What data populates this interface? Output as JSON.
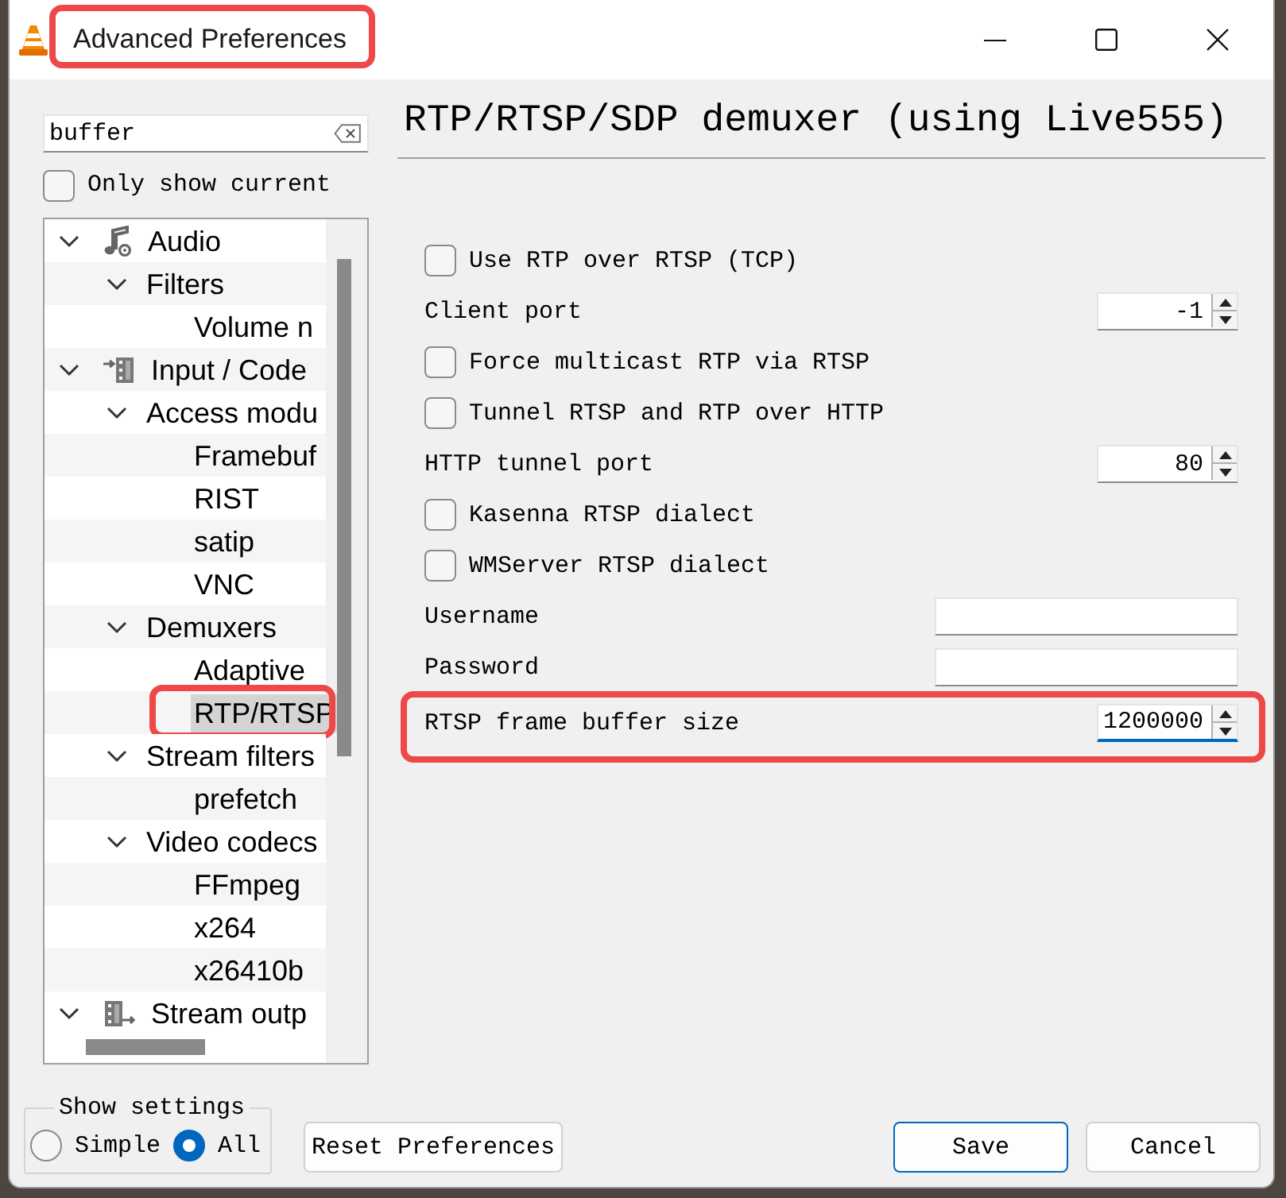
{
  "window": {
    "title": "Advanced Preferences",
    "highlighted": true
  },
  "search": {
    "value": "buffer"
  },
  "only_show_current": {
    "label": "Only show current",
    "checked": false
  },
  "tree": {
    "items": [
      {
        "label": "Audio",
        "kind": "audio",
        "expanded": true,
        "selected": false,
        "highlighted": false,
        "children": [
          {
            "label": "Filters",
            "expanded": true,
            "selected": false,
            "highlighted": false,
            "children": [
              {
                "label": "Volume n",
                "selected": false,
                "highlighted": false
              }
            ]
          }
        ]
      },
      {
        "label": "Input / Code",
        "kind": "input",
        "expanded": true,
        "selected": false,
        "highlighted": false,
        "children": [
          {
            "label": "Access modu",
            "expanded": true,
            "selected": false,
            "highlighted": false,
            "children": [
              {
                "label": "Framebuf",
                "selected": false,
                "highlighted": false
              },
              {
                "label": "RIST",
                "selected": false,
                "highlighted": false
              },
              {
                "label": "satip",
                "selected": false,
                "highlighted": false
              },
              {
                "label": "VNC",
                "selected": false,
                "highlighted": false
              }
            ]
          },
          {
            "label": "Demuxers",
            "expanded": true,
            "selected": false,
            "highlighted": false,
            "children": [
              {
                "label": "Adaptive",
                "selected": false,
                "highlighted": false
              },
              {
                "label": "RTP/RTSP",
                "selected": true,
                "highlighted": true
              }
            ]
          },
          {
            "label": "Stream filters",
            "expanded": true,
            "selected": false,
            "highlighted": false,
            "children": [
              {
                "label": "prefetch",
                "selected": false,
                "highlighted": false
              }
            ]
          },
          {
            "label": "Video codecs",
            "expanded": true,
            "selected": false,
            "highlighted": false,
            "children": [
              {
                "label": "FFmpeg",
                "selected": false,
                "highlighted": false
              },
              {
                "label": "x264",
                "selected": false,
                "highlighted": false
              },
              {
                "label": "x26410b",
                "selected": false,
                "highlighted": false
              }
            ]
          }
        ]
      },
      {
        "label": "Stream outp",
        "kind": "output",
        "expanded": true,
        "selected": false,
        "highlighted": false
      }
    ]
  },
  "panel": {
    "title": "RTP/RTSP/SDP demuxer (using Live555)",
    "settings": [
      {
        "kind": "checkbox",
        "label": "Use RTP over RTSP (TCP)",
        "checked": false,
        "highlighted": false
      },
      {
        "kind": "spin",
        "label": "Client port",
        "value": "-1",
        "focused": false,
        "highlighted": false
      },
      {
        "kind": "checkbox",
        "label": "Force multicast RTP via RTSP",
        "checked": false,
        "highlighted": false
      },
      {
        "kind": "checkbox",
        "label": "Tunnel RTSP and RTP over HTTP",
        "checked": false,
        "highlighted": false
      },
      {
        "kind": "spin",
        "label": "HTTP tunnel port",
        "value": "80",
        "focused": false,
        "highlighted": false
      },
      {
        "kind": "checkbox",
        "label": "Kasenna RTSP dialect",
        "checked": false,
        "highlighted": false
      },
      {
        "kind": "checkbox",
        "label": "WMServer RTSP dialect",
        "checked": false,
        "highlighted": false
      },
      {
        "kind": "text",
        "label": "Username",
        "focused": false,
        "highlighted": false
      },
      {
        "kind": "text",
        "label": "Password",
        "focused": false,
        "highlighted": false
      },
      {
        "kind": "spin",
        "label": "RTSP frame buffer size",
        "value": "1200000",
        "focused": true,
        "highlighted": true
      }
    ]
  },
  "show_settings": {
    "legend": "Show settings",
    "options": [
      {
        "label": "Simple",
        "selected": false
      },
      {
        "label": "All",
        "selected": true
      }
    ]
  },
  "reset_button": {
    "label": "Reset Preferences"
  },
  "buttons": [
    {
      "label": "Save",
      "default": true
    },
    {
      "label": "Cancel",
      "default": false
    }
  ]
}
